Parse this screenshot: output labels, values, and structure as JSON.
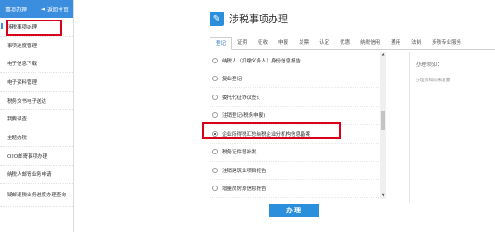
{
  "sidebar": {
    "title": "事项办理",
    "home_label": "返回主页",
    "home_icon": "arrow-left-icon",
    "items": [
      {
        "label": "涉税事项办理"
      },
      {
        "label": "事项进度管理"
      },
      {
        "label": "电子信息下载"
      },
      {
        "label": "电子资料管理"
      },
      {
        "label": "税务文书电子送达"
      },
      {
        "label": "我要读查"
      },
      {
        "label": "主题办税"
      },
      {
        "label": "O2O邮寄事项办理"
      },
      {
        "label": "纳税人邮寄业务申请"
      },
      {
        "label": "疑邮退税业务进度办理查询"
      }
    ]
  },
  "main": {
    "title": "涉税事项办理",
    "title_icon": "edit-icon",
    "tabs": [
      "登记",
      "证明",
      "征收",
      "申报",
      "发票",
      "认定",
      "优惠",
      "纳税信用",
      "通用",
      "法制",
      "涉税专业服务"
    ],
    "active_tab": "登记",
    "options": [
      {
        "label": "纳税人（扣缴义务人）身份信息报告",
        "checked": false
      },
      {
        "label": "复业登记",
        "checked": false
      },
      {
        "label": "委托代征协议签订",
        "checked": false
      },
      {
        "label": "注销登记(税务申报)",
        "checked": false
      },
      {
        "label": "企业所得税汇总纳税企业分机构信息备案",
        "checked": true
      },
      {
        "label": "税务证件增补发",
        "checked": false
      },
      {
        "label": "注销建筑业项目报告",
        "checked": false
      },
      {
        "label": "增量房房源信息报告",
        "checked": false
      }
    ],
    "side_panel": {
      "title": "办理须知：",
      "subtitle": "办理须知尚未设置"
    },
    "submit_label": "办理"
  },
  "colors": {
    "accent": "#2b8fdc",
    "highlight": "#d9001b"
  }
}
